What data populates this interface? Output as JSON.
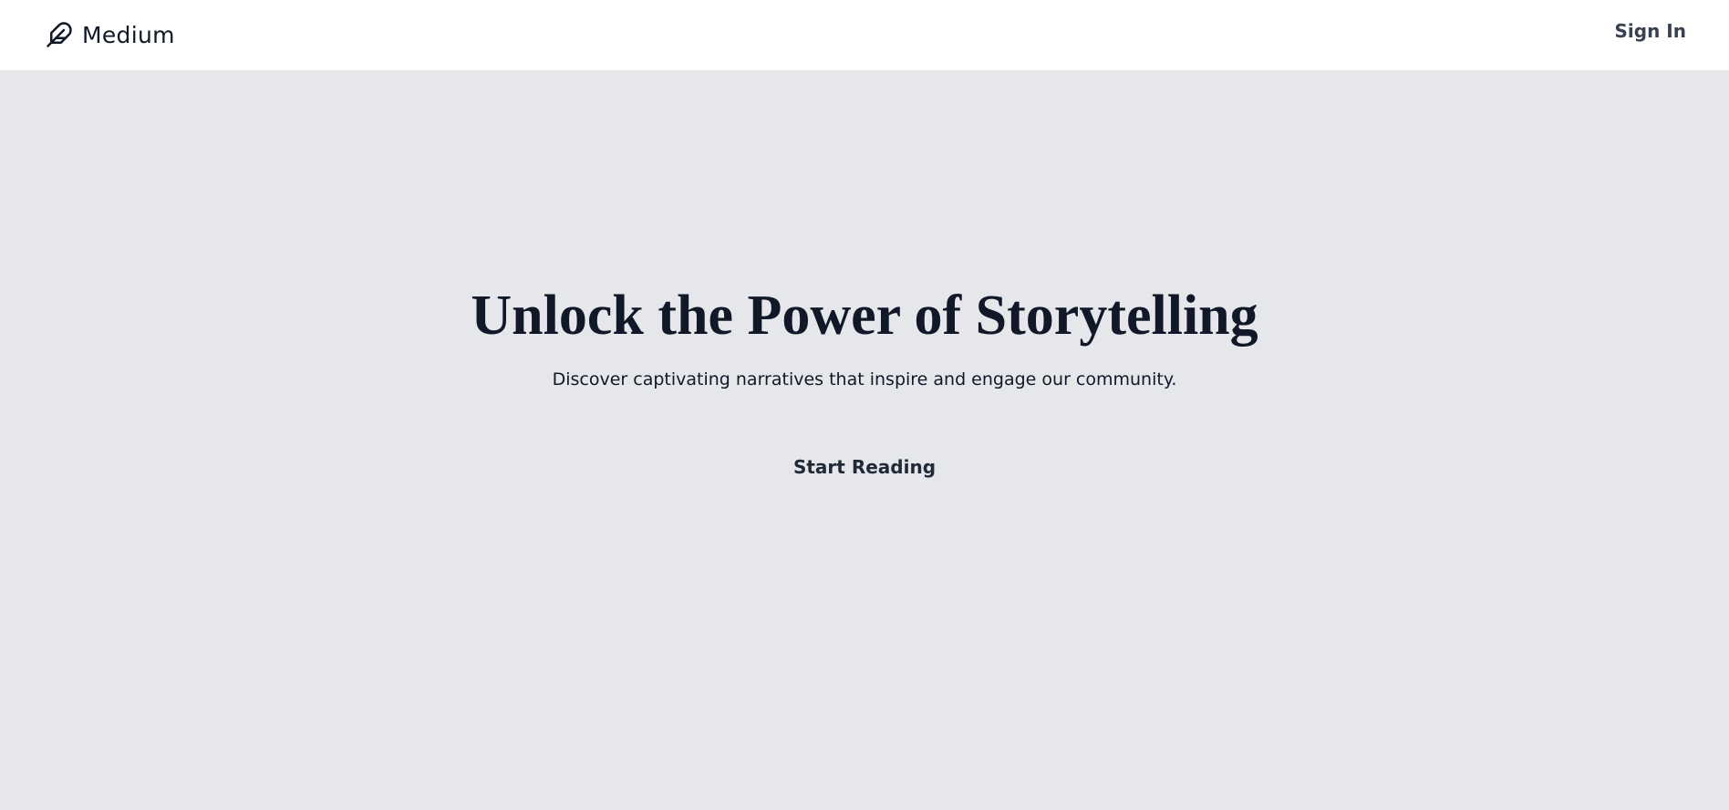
{
  "header": {
    "brand": {
      "name": "Medium",
      "icon": "feather-icon"
    },
    "sign_in_label": "Sign In"
  },
  "hero": {
    "title": "Unlock the Power of Storytelling",
    "subtitle": "Discover captivating narratives that inspire and engage our community.",
    "cta_label": "Start Reading"
  },
  "colors": {
    "page_background": "#e5e7eb",
    "header_background": "#ffffff",
    "text_primary": "#111827",
    "text_secondary": "#374151"
  }
}
